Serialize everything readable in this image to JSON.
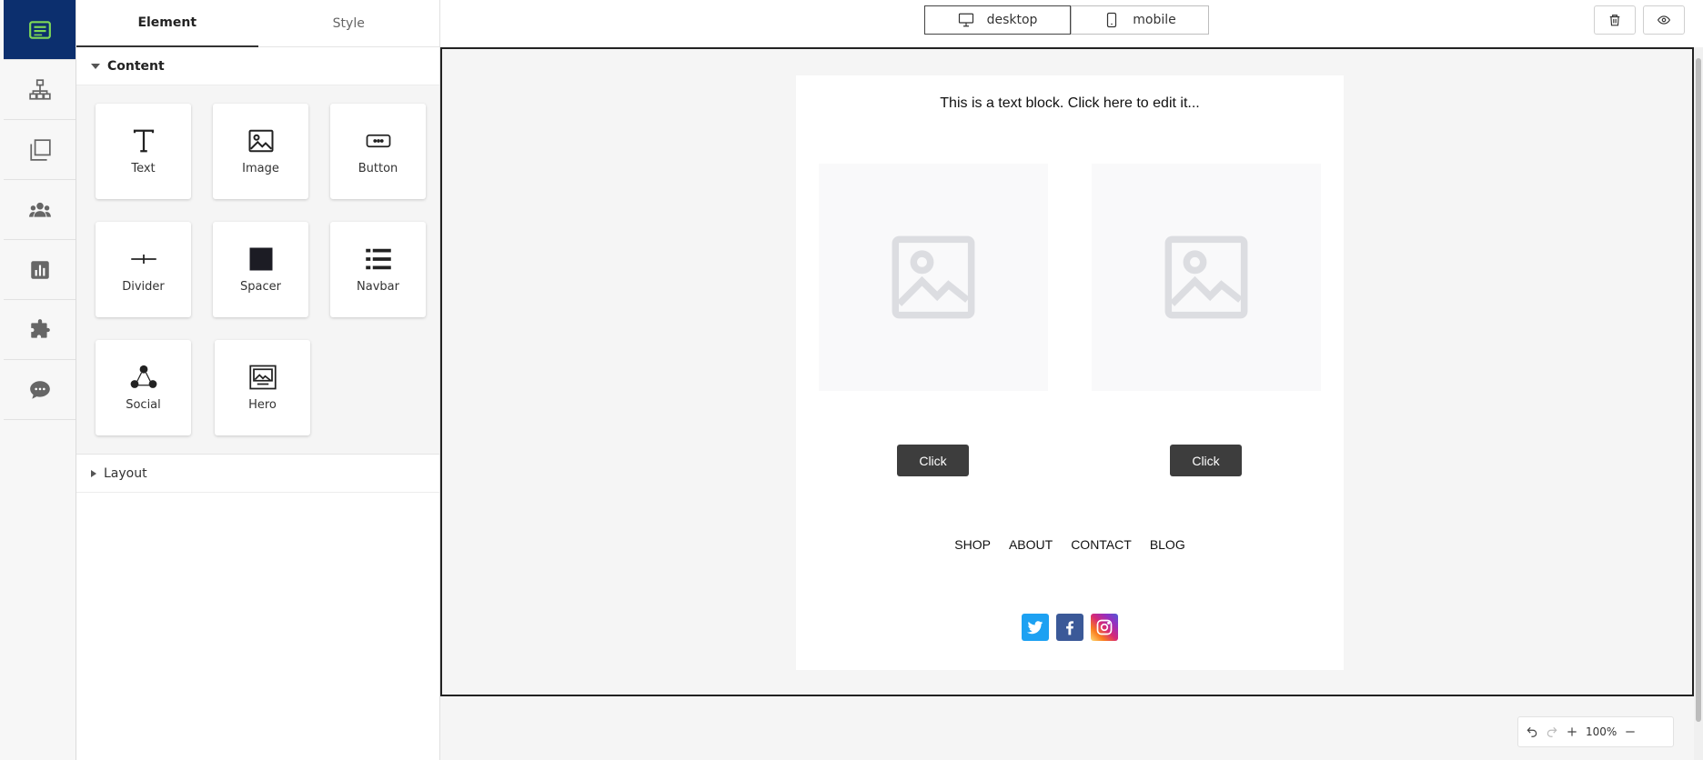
{
  "rail": {
    "items": [
      {
        "icon": "email-template-icon",
        "active": true
      },
      {
        "icon": "sitemap-icon",
        "active": false
      },
      {
        "icon": "pages-icon",
        "active": false
      },
      {
        "icon": "users-icon",
        "active": false
      },
      {
        "icon": "chart-icon",
        "active": false
      },
      {
        "icon": "puzzle-icon",
        "active": false
      },
      {
        "icon": "chat-icon",
        "active": false
      }
    ]
  },
  "panel": {
    "tabs": [
      {
        "label": "Element"
      },
      {
        "label": "Style"
      }
    ],
    "content_section": "Content",
    "layout_section": "Layout",
    "blocks": [
      {
        "label": "Text",
        "icon": "text-icon"
      },
      {
        "label": "Image",
        "icon": "image-icon"
      },
      {
        "label": "Button",
        "icon": "button-icon"
      },
      {
        "label": "Divider",
        "icon": "divider-icon"
      },
      {
        "label": "Spacer",
        "icon": "spacer-icon"
      },
      {
        "label": "Navbar",
        "icon": "navbar-icon"
      },
      {
        "label": "Social",
        "icon": "social-icon"
      },
      {
        "label": "Hero",
        "icon": "hero-icon"
      }
    ]
  },
  "toolbar": {
    "devices": [
      {
        "label": "desktop",
        "active": true
      },
      {
        "label": "mobile",
        "active": false
      }
    ],
    "delete_icon": "trash-icon",
    "preview_icon": "eye-icon"
  },
  "email": {
    "text_block": "This is a text block. Click here to edit it...",
    "buttons": [
      {
        "label": "Click"
      },
      {
        "label": "Click"
      }
    ],
    "nav": [
      "SHOP",
      "ABOUT",
      "CONTACT",
      "BLOG"
    ],
    "social": [
      {
        "name": "twitter",
        "color": "#1da1f2"
      },
      {
        "name": "facebook",
        "color": "#3b5998"
      },
      {
        "name": "instagram",
        "color": "#e1306c"
      }
    ]
  },
  "zoom": {
    "level": "100%"
  },
  "colors": {
    "rail_active": "#0c2f6e",
    "rail_active_icon": "#7ed957",
    "button_bg": "#3d3d3d"
  }
}
